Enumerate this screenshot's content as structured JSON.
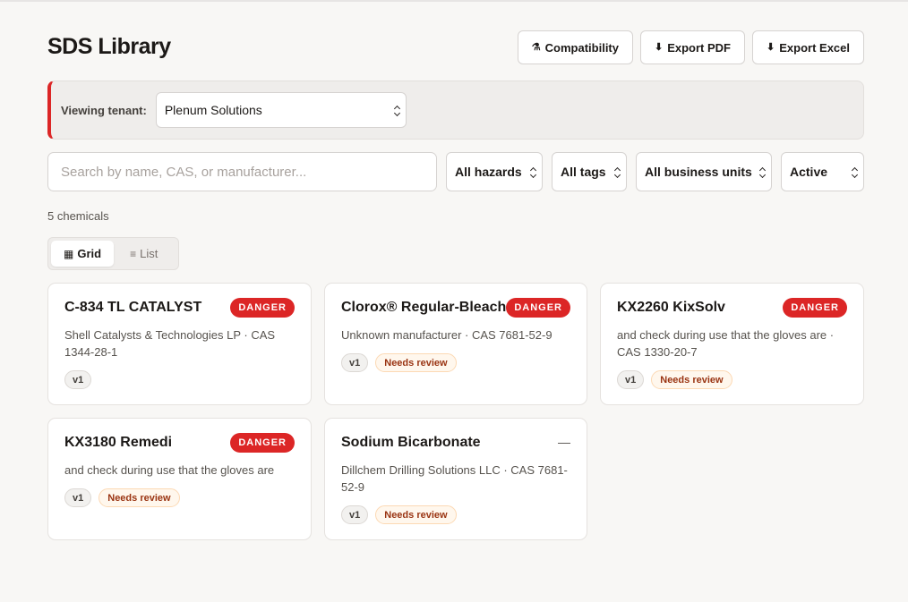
{
  "header": {
    "title": "SDS Library",
    "actions": [
      {
        "icon": "⚗",
        "icon_name": "flask-icon",
        "label": "Compatibility"
      },
      {
        "icon": "⬇",
        "icon_name": "download-icon",
        "label": "Export PDF"
      },
      {
        "icon": "⬇",
        "icon_name": "download-icon",
        "label": "Export Excel"
      }
    ]
  },
  "tenant": {
    "label": "Viewing tenant:",
    "selected": "Plenum Solutions",
    "accent": "#dc2626"
  },
  "filters": {
    "search_placeholder": "Search by name, CAS, or manufacturer...",
    "search_value": "",
    "hazards": "All hazards",
    "tags": "All tags",
    "business_units": "All business units",
    "status": "Active"
  },
  "results": {
    "count_text": "5 chemicals"
  },
  "view_toggle": {
    "grid_icon": "▦",
    "grid_label": "Grid",
    "list_icon": "≡",
    "list_label": "List",
    "active": "grid"
  },
  "chemicals": [
    {
      "name": "C-834 TL CATALYST",
      "signal": "DANGER",
      "subtitle": "Shell Catalysts & Technologies LP · CAS 1344-28-1",
      "version": "v1",
      "review": ""
    },
    {
      "name": "Clorox® Regular-Bleach",
      "signal": "DANGER",
      "subtitle": "Unknown manufacturer · CAS 7681-52-9",
      "version": "v1",
      "review": "Needs review"
    },
    {
      "name": "KX2260 KixSolv",
      "signal": "DANGER",
      "subtitle": "and check during use that the gloves are · CAS 1330-20-7",
      "version": "v1",
      "review": "Needs review"
    },
    {
      "name": "KX3180 Remedi",
      "signal": "DANGER",
      "subtitle": "and check during use that the gloves are",
      "version": "v1",
      "review": "Needs review"
    },
    {
      "name": "Sodium Bicarbonate",
      "signal": "—",
      "subtitle": "Dillchem Drilling Solutions LLC · CAS 7681-52-9",
      "version": "v1",
      "review": "Needs review"
    }
  ],
  "colors": {
    "danger": "#dc2626",
    "background": "#f8f7f5",
    "review_bg": "#fff7ed",
    "review_text": "#9a3412"
  }
}
